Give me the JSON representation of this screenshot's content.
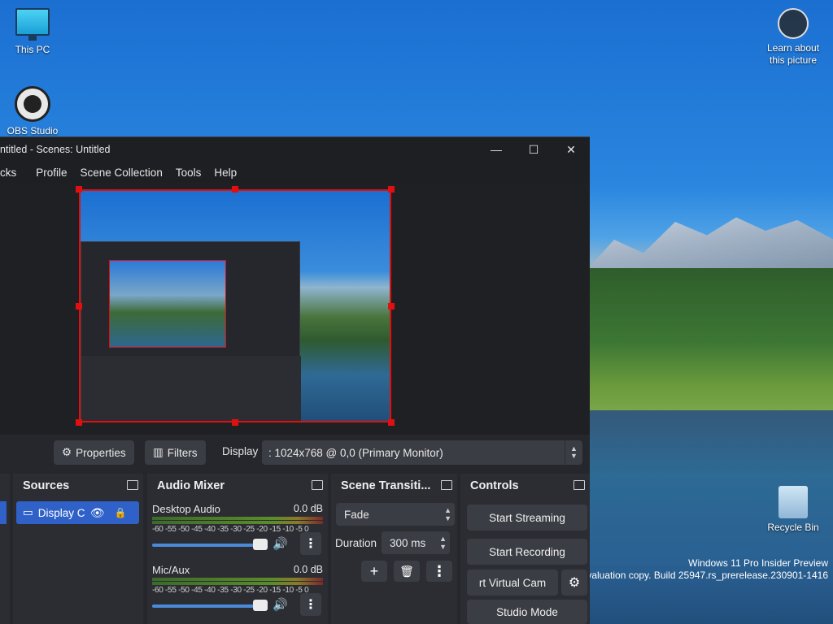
{
  "desktop": {
    "icons": {
      "this_pc": "This PC",
      "obs": "OBS Studio",
      "learn": "Learn about this picture",
      "recycle_bin": "Recycle Bin"
    },
    "watermark": {
      "line1": "Windows 11 Pro Insider Preview",
      "line2": "Evaluation copy. Build 25947.rs_prerelease.230901-1416"
    }
  },
  "window": {
    "title": "ntitled - Scenes: Untitled",
    "controls": {
      "minimize": "—",
      "maximize": "☐",
      "close": "✕"
    }
  },
  "menubar": [
    "cks",
    "Profile",
    "Scene Collection",
    "Tools",
    "Help"
  ],
  "propbar": {
    "properties": "Properties",
    "filters": "Filters",
    "display_label": "Display",
    "display_value": ": 1024x768 @ 0,0 (Primary Monitor)"
  },
  "docks": {
    "sources": {
      "title": "Sources",
      "item": "Display Ca"
    },
    "audio_mixer": {
      "title": "Audio Mixer",
      "ticks": "-60 -55 -50 -45 -40 -35 -30 -25 -20 -15 -10 -5  0",
      "channels": [
        {
          "name": "Desktop Audio",
          "db": "0.0 dB"
        },
        {
          "name": "Mic/Aux",
          "db": "0.0 dB"
        }
      ]
    },
    "transitions": {
      "title": "Scene Transiti...",
      "type": "Fade",
      "duration_label": "Duration",
      "duration_value": "300 ms"
    },
    "controls": {
      "title": "Controls",
      "start_streaming": "Start Streaming",
      "start_recording": "Start Recording",
      "virtual_cam": "rt Virtual Cam",
      "studio_mode": "Studio Mode"
    }
  }
}
